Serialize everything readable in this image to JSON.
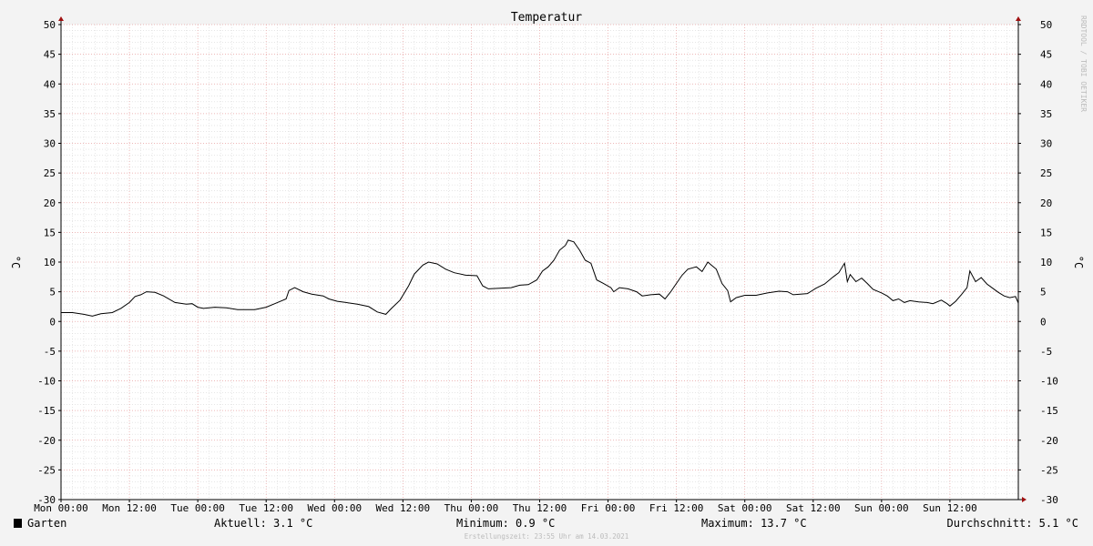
{
  "chart_data": {
    "type": "line",
    "title": "Temperatur",
    "ylabel": "°C",
    "ylabel_right": "°C",
    "ylim": [
      -30,
      50
    ],
    "yticks": [
      50,
      45,
      40,
      35,
      30,
      25,
      20,
      15,
      10,
      5,
      0,
      -5,
      -10,
      -15,
      -20,
      -25,
      -30
    ],
    "xlim": [
      0,
      168
    ],
    "xticks": [
      {
        "hour": 0,
        "label": "Mon 00:00"
      },
      {
        "hour": 12,
        "label": "Mon 12:00"
      },
      {
        "hour": 24,
        "label": "Tue 00:00"
      },
      {
        "hour": 36,
        "label": "Tue 12:00"
      },
      {
        "hour": 48,
        "label": "Wed 00:00"
      },
      {
        "hour": 60,
        "label": "Wed 12:00"
      },
      {
        "hour": 72,
        "label": "Thu 00:00"
      },
      {
        "hour": 84,
        "label": "Thu 12:00"
      },
      {
        "hour": 96,
        "label": "Fri 00:00"
      },
      {
        "hour": 108,
        "label": "Fri 12:00"
      },
      {
        "hour": 120,
        "label": "Sat 00:00"
      },
      {
        "hour": 132,
        "label": "Sat 12:00"
      },
      {
        "hour": 144,
        "label": "Sun 00:00"
      },
      {
        "hour": 156,
        "label": "Sun 12:00"
      }
    ],
    "grid": true,
    "series": [
      {
        "name": "Garten",
        "color": "#000000",
        "points": [
          [
            0,
            1.5
          ],
          [
            2,
            1.5
          ],
          [
            4,
            1.2
          ],
          [
            5.5,
            0.9
          ],
          [
            7,
            1.3
          ],
          [
            9,
            1.5
          ],
          [
            10.5,
            2.2
          ],
          [
            12,
            3.2
          ],
          [
            13,
            4.2
          ],
          [
            14,
            4.5
          ],
          [
            15,
            5.0
          ],
          [
            16.5,
            4.9
          ],
          [
            18,
            4.3
          ],
          [
            20,
            3.2
          ],
          [
            22,
            2.9
          ],
          [
            23,
            3.0
          ],
          [
            24,
            2.4
          ],
          [
            25,
            2.2
          ],
          [
            27,
            2.4
          ],
          [
            29,
            2.3
          ],
          [
            31,
            2.0
          ],
          [
            34,
            2.0
          ],
          [
            36,
            2.4
          ],
          [
            38,
            3.2
          ],
          [
            39.5,
            3.8
          ],
          [
            40,
            5.2
          ],
          [
            41,
            5.7
          ],
          [
            42.5,
            5.0
          ],
          [
            44,
            4.6
          ],
          [
            46,
            4.3
          ],
          [
            47,
            3.8
          ],
          [
            48.5,
            3.4
          ],
          [
            50,
            3.2
          ],
          [
            52,
            2.9
          ],
          [
            54,
            2.5
          ],
          [
            55.5,
            1.6
          ],
          [
            57,
            1.2
          ],
          [
            58,
            2.2
          ],
          [
            59.5,
            3.6
          ],
          [
            61,
            6.0
          ],
          [
            62,
            8.0
          ],
          [
            63.5,
            9.5
          ],
          [
            64.5,
            10.0
          ],
          [
            66,
            9.7
          ],
          [
            67.5,
            8.8
          ],
          [
            69,
            8.2
          ],
          [
            71,
            7.8
          ],
          [
            73,
            7.7
          ],
          [
            74,
            6.0
          ],
          [
            75,
            5.5
          ],
          [
            77,
            5.6
          ],
          [
            79,
            5.7
          ],
          [
            80.5,
            6.1
          ],
          [
            82,
            6.2
          ],
          [
            83.5,
            7.0
          ],
          [
            84.5,
            8.5
          ],
          [
            85.5,
            9.2
          ],
          [
            86.5,
            10.3
          ],
          [
            87.5,
            12.0
          ],
          [
            88.5,
            12.8
          ],
          [
            89,
            13.7
          ],
          [
            90,
            13.4
          ],
          [
            91,
            12.0
          ],
          [
            92,
            10.3
          ],
          [
            93,
            9.8
          ],
          [
            94,
            7.0
          ],
          [
            95,
            6.5
          ],
          [
            96.5,
            5.7
          ],
          [
            97,
            5.0
          ],
          [
            98,
            5.7
          ],
          [
            99.5,
            5.5
          ],
          [
            101,
            5.0
          ],
          [
            102,
            4.3
          ],
          [
            103.5,
            4.5
          ],
          [
            105,
            4.6
          ],
          [
            106,
            3.8
          ],
          [
            107,
            5.0
          ],
          [
            108,
            6.4
          ],
          [
            109,
            7.8
          ],
          [
            110,
            8.8
          ],
          [
            111.5,
            9.2
          ],
          [
            112.5,
            8.4
          ],
          [
            113.5,
            10.0
          ],
          [
            114.5,
            9.2
          ],
          [
            115,
            8.8
          ],
          [
            116,
            6.4
          ],
          [
            117,
            5.2
          ],
          [
            117.5,
            3.3
          ],
          [
            118.5,
            4.0
          ],
          [
            120,
            4.4
          ],
          [
            122,
            4.4
          ],
          [
            124,
            4.8
          ],
          [
            126,
            5.1
          ],
          [
            127.5,
            5.0
          ],
          [
            128.5,
            4.5
          ],
          [
            131,
            4.7
          ],
          [
            132.5,
            5.6
          ],
          [
            134,
            6.3
          ],
          [
            135.5,
            7.5
          ],
          [
            136.5,
            8.2
          ],
          [
            137.5,
            9.8
          ],
          [
            138,
            6.7
          ],
          [
            138.5,
            7.9
          ],
          [
            139.5,
            6.7
          ],
          [
            140.5,
            7.3
          ],
          [
            141.5,
            6.4
          ],
          [
            142.5,
            5.4
          ],
          [
            144,
            4.8
          ],
          [
            145,
            4.3
          ],
          [
            146,
            3.5
          ],
          [
            147,
            3.8
          ],
          [
            148,
            3.2
          ],
          [
            149,
            3.5
          ],
          [
            150.5,
            3.3
          ],
          [
            152,
            3.2
          ],
          [
            153,
            3.0
          ],
          [
            154.5,
            3.6
          ],
          [
            155.5,
            3.0
          ],
          [
            156,
            2.6
          ],
          [
            157,
            3.4
          ],
          [
            158,
            4.5
          ],
          [
            159,
            5.7
          ],
          [
            159.5,
            8.5
          ],
          [
            160.5,
            6.7
          ],
          [
            161.5,
            7.4
          ],
          [
            162.5,
            6.3
          ],
          [
            163.5,
            5.6
          ],
          [
            164.5,
            4.9
          ],
          [
            165.5,
            4.3
          ],
          [
            166.5,
            4.0
          ],
          [
            167.5,
            4.2
          ],
          [
            168,
            3.1
          ]
        ]
      }
    ]
  },
  "legend": {
    "series_name": "Garten",
    "swatch_color": "#000000",
    "current": "Aktuell: 3.1 °C",
    "minimum": "Minimum: 0.9 °C",
    "maximum": "Maximum: 13.7 °C",
    "average": "Durchschnitt: 5.1 °C"
  },
  "footer": {
    "created": "Erstellungszeit: 23:55 Uhr am 14.03.2021"
  },
  "watermark": "RRDTOOL / TOBI OETIKER",
  "colors": {
    "background": "#f3f3f3",
    "plot_background": "#ffffff",
    "major_grid": "#e8a0a0",
    "minor_grid": "#d8d8d8",
    "axis": "#000000",
    "arrow": "#a01010"
  }
}
